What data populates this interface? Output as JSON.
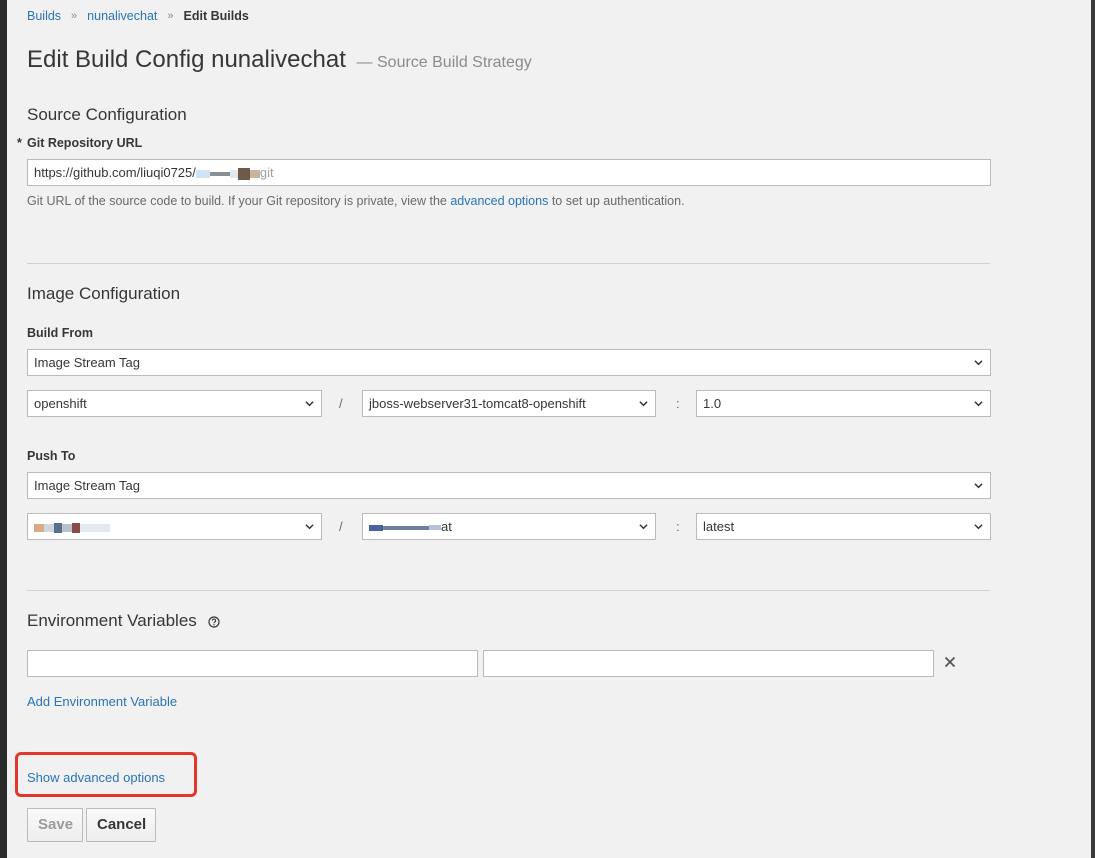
{
  "breadcrumb": {
    "items": [
      "Builds",
      "nunalivechat"
    ],
    "current": "Edit Builds",
    "separator": "»"
  },
  "title": {
    "main": "Edit Build Config nunalivechat",
    "subtitle": "— Source Build Strategy"
  },
  "source": {
    "heading": "Source Configuration",
    "required_marker": "*",
    "git_label": "Git Repository URL",
    "git_value": "https://github.com/liuqi0725/",
    "git_value_tail": "git",
    "help_before": "Git URL of the source code to build. If your Git repository is private, view the ",
    "help_link": "advanced options",
    "help_after": " to set up authentication."
  },
  "image": {
    "heading": "Image Configuration",
    "build_from_label": "Build From",
    "build_from_kind": "Image Stream Tag",
    "build_from_namespace": "openshift",
    "build_from_stream": "jboss-webserver31-tomcat8-openshift",
    "build_from_tag": "1.0",
    "push_to_label": "Push To",
    "push_to_kind": "Image Stream Tag",
    "push_to_namespace": "",
    "push_to_stream_tail": "at",
    "push_to_tag": "latest",
    "slash": "/",
    "colon": ":"
  },
  "env": {
    "heading": "Environment Variables",
    "name_value": "",
    "value_value": "",
    "add_link": "Add Environment Variable"
  },
  "advanced_link": "Show advanced options",
  "buttons": {
    "save": "Save",
    "cancel": "Cancel"
  },
  "colors": {
    "link": "#2a74b8",
    "highlight": "#e0382a"
  }
}
